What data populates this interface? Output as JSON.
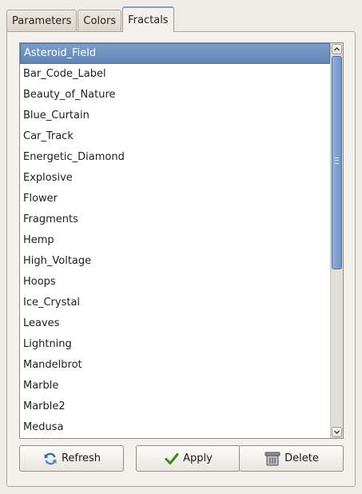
{
  "tabs": [
    {
      "label": "Parameters"
    },
    {
      "label": "Colors"
    },
    {
      "label": "Fractals",
      "active": true
    }
  ],
  "list": {
    "selected_index": 0,
    "items": [
      "Asteroid_Field",
      "Bar_Code_Label",
      "Beauty_of_Nature",
      "Blue_Curtain",
      "Car_Track",
      "Energetic_Diamond",
      "Explosive",
      "Flower",
      "Fragments",
      "Hemp",
      "High_Voltage",
      "Hoops",
      "Ice_Crystal",
      "Leaves",
      "Lightning",
      "Mandelbrot",
      "Marble",
      "Marble2",
      "Medusa"
    ]
  },
  "buttons": {
    "refresh": {
      "label": "Refresh",
      "icon": "refresh-icon"
    },
    "apply": {
      "label": "Apply",
      "icon": "checkmark-icon"
    },
    "delete": {
      "label": "Delete",
      "icon": "trash-icon"
    }
  },
  "colors": {
    "selection": "#6a8fbf",
    "background": "#efebe7"
  }
}
